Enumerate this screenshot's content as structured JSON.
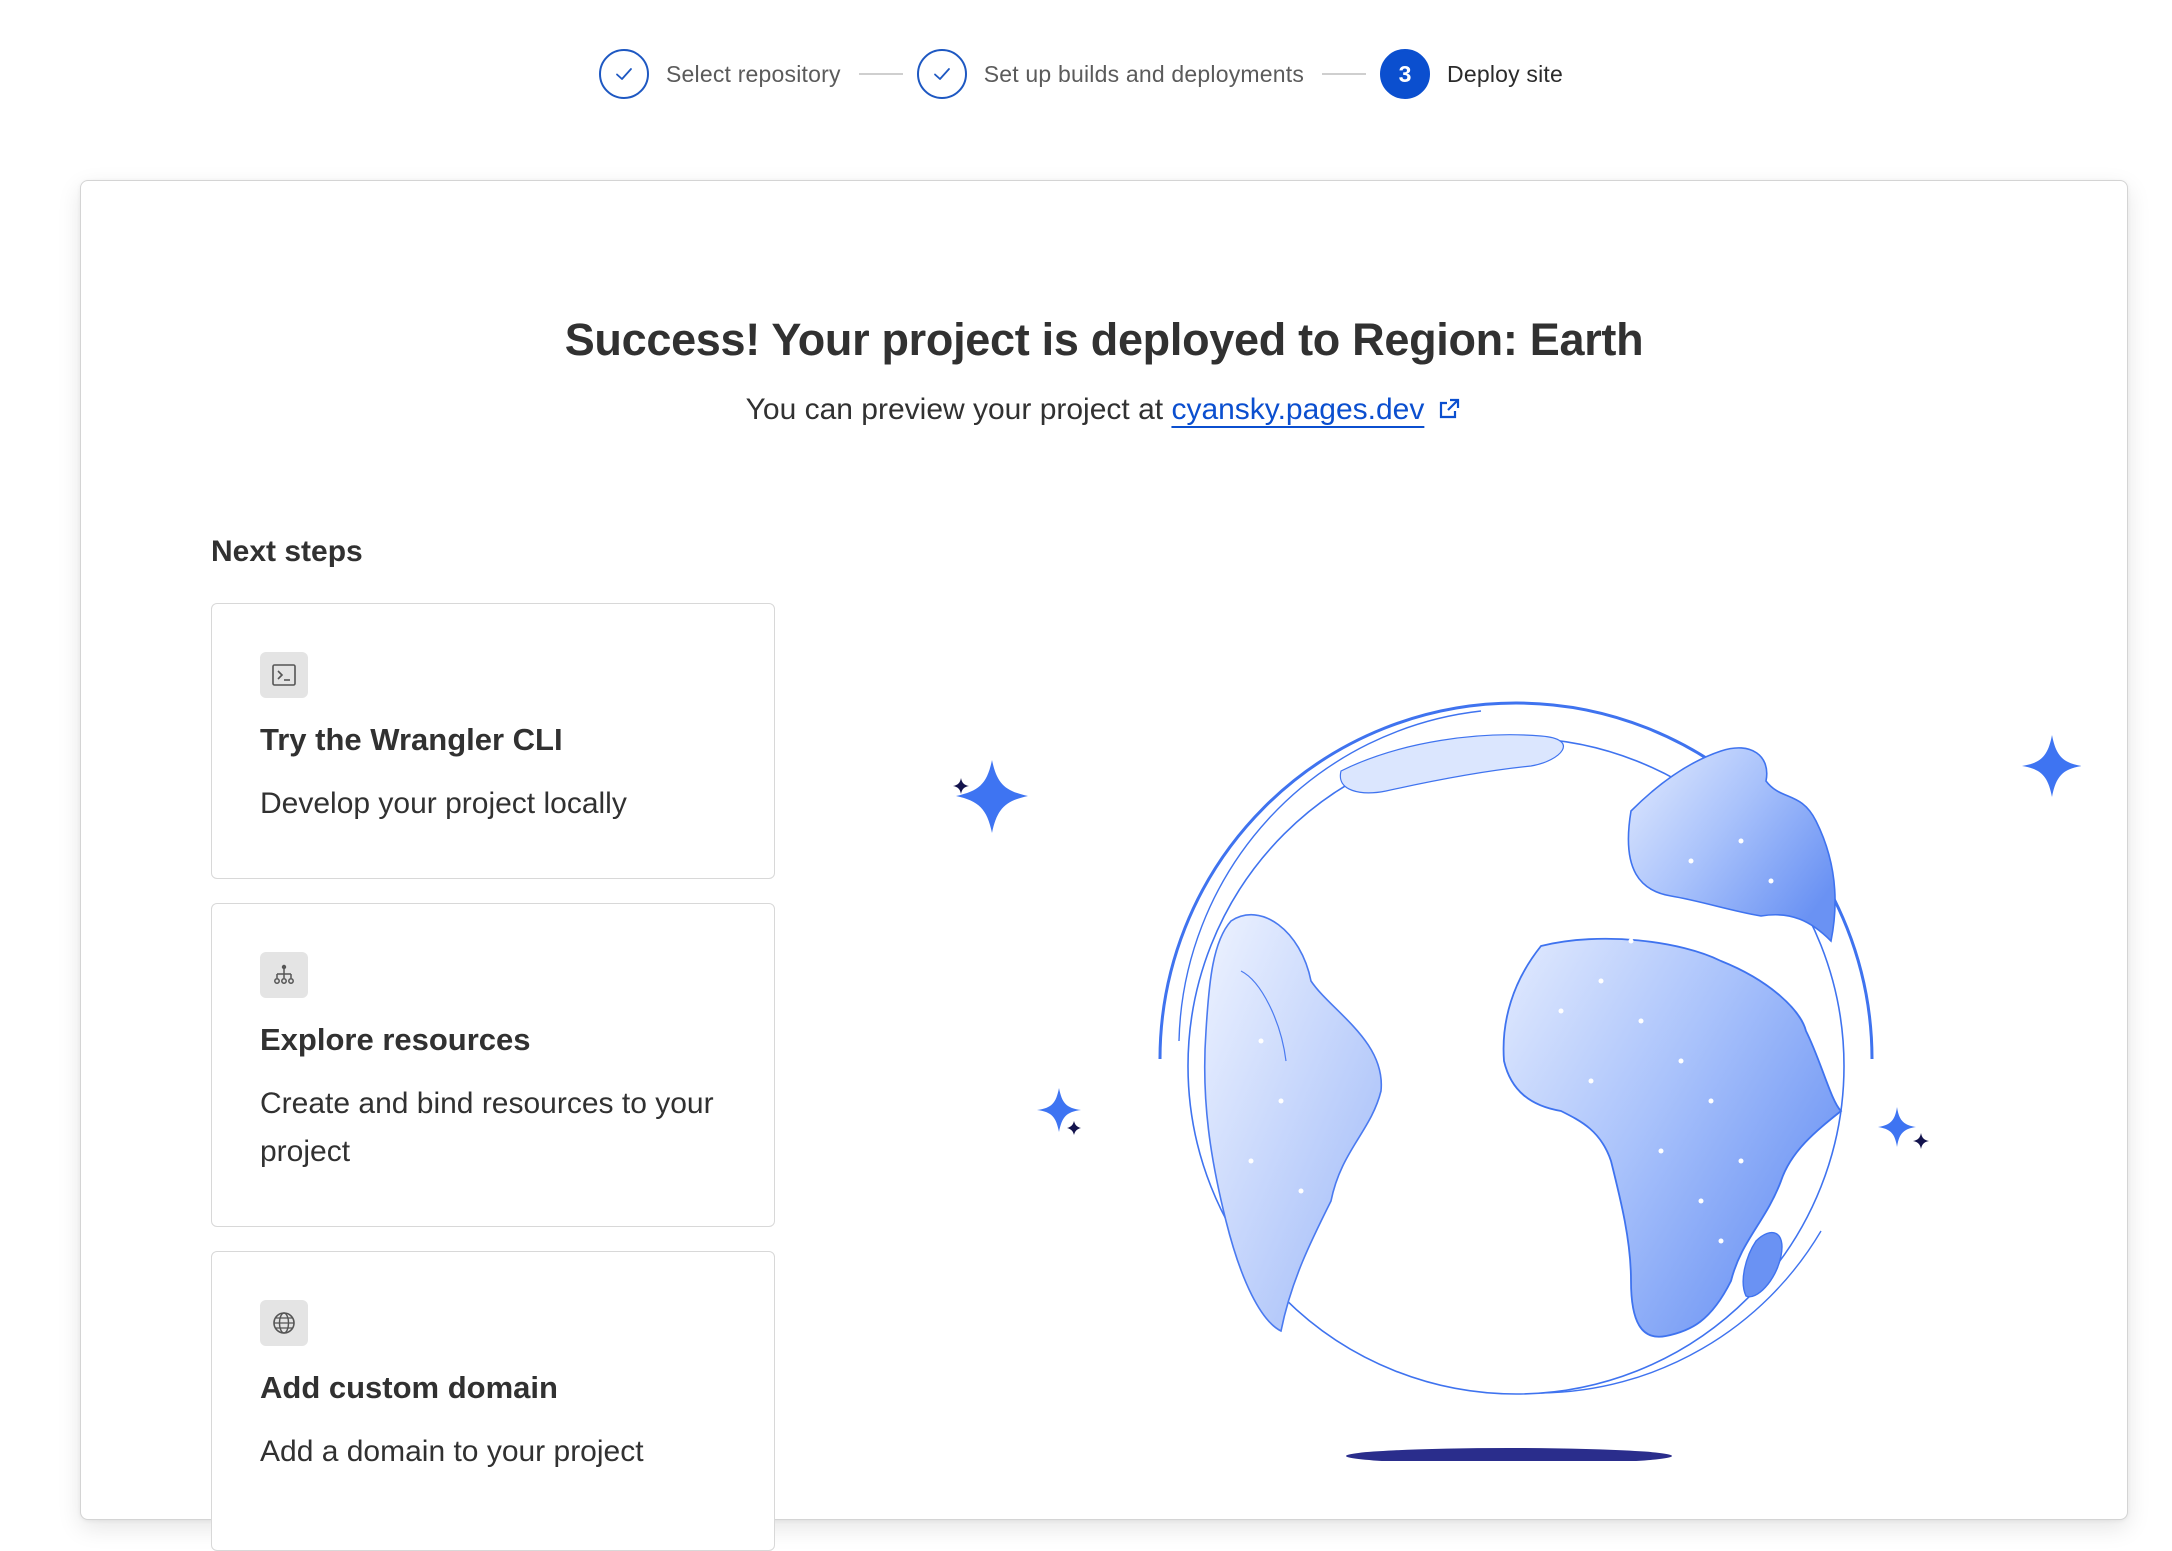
{
  "stepper": {
    "steps": [
      {
        "number": "1",
        "label": "Select repository",
        "state": "completed",
        "icon": "check-icon"
      },
      {
        "number": "2",
        "label": "Set up builds and deployments",
        "state": "completed",
        "icon": "check-icon"
      },
      {
        "number": "3",
        "label": "Deploy site",
        "state": "active"
      }
    ]
  },
  "success": {
    "headline": "Success! Your project is deployed to Region: Earth",
    "preview_prefix": "You can preview your project at",
    "preview_link": "cyansky.pages.dev",
    "link_icon": "external-link-icon"
  },
  "next_steps": {
    "title": "Next steps",
    "items": [
      {
        "icon": "terminal-icon",
        "title": "Try the Wrangler CLI",
        "description": "Develop your project locally"
      },
      {
        "icon": "sitemap-icon",
        "title": "Explore resources",
        "description": "Create and bind resources to your project"
      },
      {
        "icon": "globe-icon",
        "title": "Add custom domain",
        "description": "Add a domain to your project"
      }
    ]
  },
  "illustration": {
    "name": "earth-globe-illustration",
    "colors": {
      "accent": "#0b4fcf",
      "globe_light": "#d6e2fd",
      "globe_dark": "#6a92f3",
      "outline": "#3f73ef",
      "sparkle_blue": "#3e74f2",
      "sparkle_navy": "#13134d",
      "shadow": "#2a2d8c"
    }
  }
}
